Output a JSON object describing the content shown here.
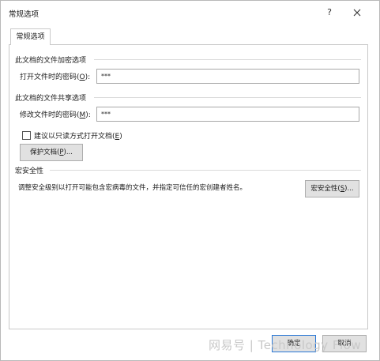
{
  "window": {
    "title": "常规选项",
    "help_glyph": "?",
    "close_icon": "close-icon"
  },
  "tabs": [
    {
      "label": "常规选项",
      "selected": true
    }
  ],
  "encrypt": {
    "section_title": "此文档的文件加密选项",
    "open_password_label": "打开文件时的密码(",
    "open_password_key": "O",
    "open_password_suffix": "):",
    "open_password_value": "***"
  },
  "share": {
    "section_title": "此文档的文件共享选项",
    "modify_password_label": "修改文件时的密码(",
    "modify_password_key": "M",
    "modify_password_suffix": "):",
    "modify_password_value": "***",
    "readonly_checkbox_label": "建议以只读方式打开文档(",
    "readonly_checkbox_key": "E",
    "readonly_checkbox_suffix": ")",
    "readonly_checked": false,
    "protect_button_label": "保护文档(",
    "protect_button_key": "P",
    "protect_button_suffix": ")..."
  },
  "macro": {
    "section_title": "宏安全性",
    "description": "调整安全级别以打开可能包含宏病毒的文件，并指定可信任的宏创建者姓名。",
    "security_button_label": "宏安全性(",
    "security_button_key": "S",
    "security_button_suffix": ")..."
  },
  "footer": {
    "ok_label": "确定",
    "cancel_label": "取消"
  },
  "watermark": "网易号 | Technology Flow"
}
